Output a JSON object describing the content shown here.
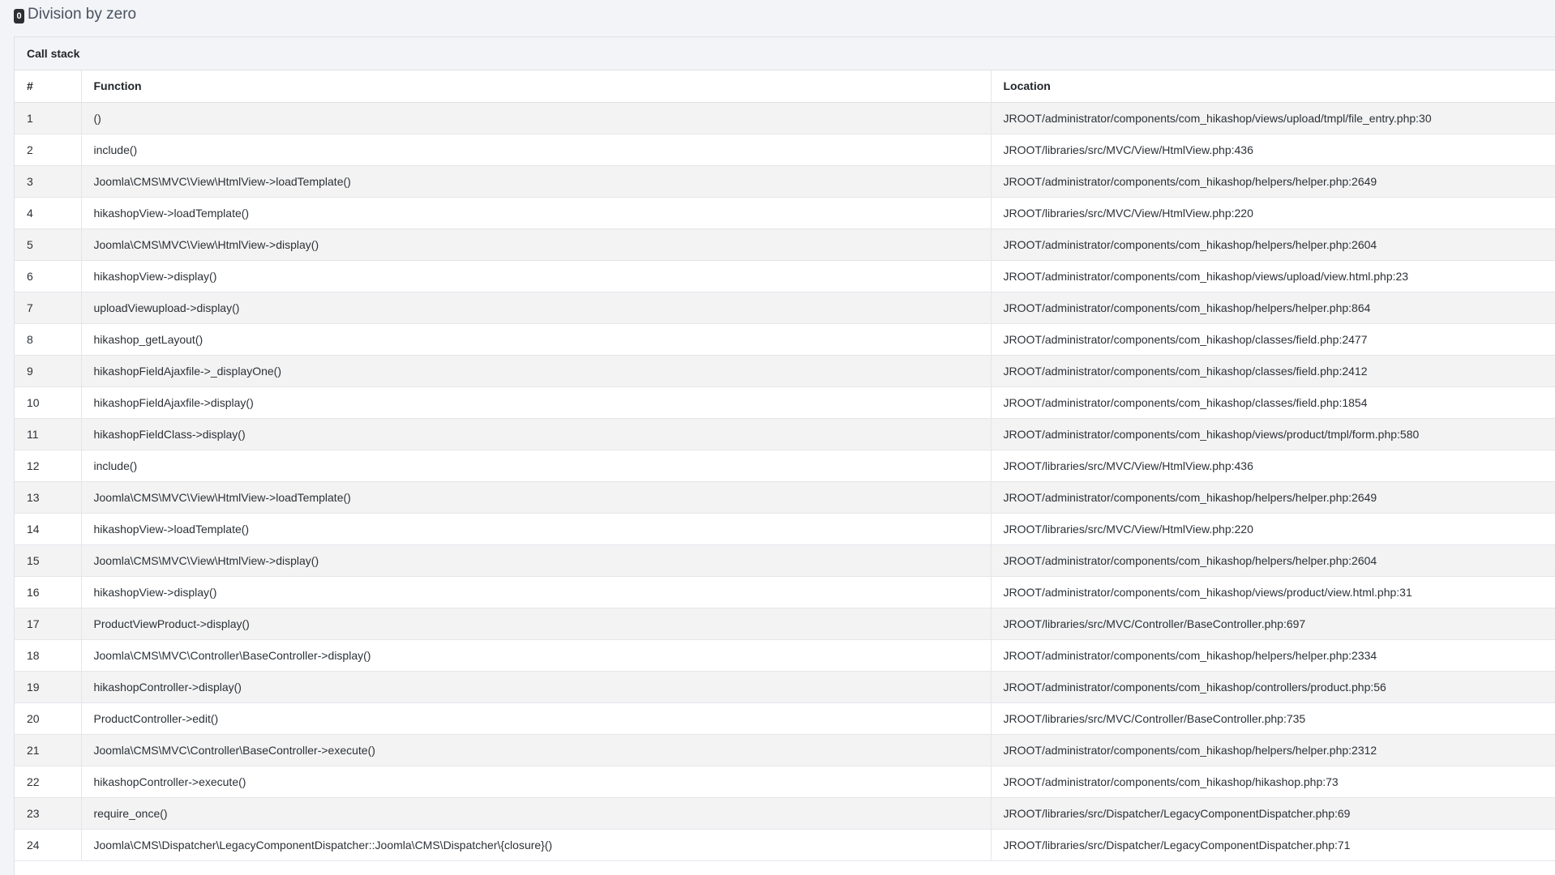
{
  "error": {
    "code": "0",
    "message": "Division by zero"
  },
  "call_stack": {
    "caption": "Call stack",
    "headers": {
      "num": "#",
      "function": "Function",
      "location": "Location"
    },
    "rows": [
      {
        "num": "1",
        "function": "()",
        "location": "JROOT/administrator/components/com_hikashop/views/upload/tmpl/file_entry.php:30"
      },
      {
        "num": "2",
        "function": "include()",
        "location": "JROOT/libraries/src/MVC/View/HtmlView.php:436"
      },
      {
        "num": "3",
        "function": "Joomla\\CMS\\MVC\\View\\HtmlView->loadTemplate()",
        "location": "JROOT/administrator/components/com_hikashop/helpers/helper.php:2649"
      },
      {
        "num": "4",
        "function": "hikashopView->loadTemplate()",
        "location": "JROOT/libraries/src/MVC/View/HtmlView.php:220"
      },
      {
        "num": "5",
        "function": "Joomla\\CMS\\MVC\\View\\HtmlView->display()",
        "location": "JROOT/administrator/components/com_hikashop/helpers/helper.php:2604"
      },
      {
        "num": "6",
        "function": "hikashopView->display()",
        "location": "JROOT/administrator/components/com_hikashop/views/upload/view.html.php:23"
      },
      {
        "num": "7",
        "function": "uploadViewupload->display()",
        "location": "JROOT/administrator/components/com_hikashop/helpers/helper.php:864"
      },
      {
        "num": "8",
        "function": "hikashop_getLayout()",
        "location": "JROOT/administrator/components/com_hikashop/classes/field.php:2477"
      },
      {
        "num": "9",
        "function": "hikashopFieldAjaxfile->_displayOne()",
        "location": "JROOT/administrator/components/com_hikashop/classes/field.php:2412"
      },
      {
        "num": "10",
        "function": "hikashopFieldAjaxfile->display()",
        "location": "JROOT/administrator/components/com_hikashop/classes/field.php:1854"
      },
      {
        "num": "11",
        "function": "hikashopFieldClass->display()",
        "location": "JROOT/administrator/components/com_hikashop/views/product/tmpl/form.php:580"
      },
      {
        "num": "12",
        "function": "include()",
        "location": "JROOT/libraries/src/MVC/View/HtmlView.php:436"
      },
      {
        "num": "13",
        "function": "Joomla\\CMS\\MVC\\View\\HtmlView->loadTemplate()",
        "location": "JROOT/administrator/components/com_hikashop/helpers/helper.php:2649"
      },
      {
        "num": "14",
        "function": "hikashopView->loadTemplate()",
        "location": "JROOT/libraries/src/MVC/View/HtmlView.php:220"
      },
      {
        "num": "15",
        "function": "Joomla\\CMS\\MVC\\View\\HtmlView->display()",
        "location": "JROOT/administrator/components/com_hikashop/helpers/helper.php:2604"
      },
      {
        "num": "16",
        "function": "hikashopView->display()",
        "location": "JROOT/administrator/components/com_hikashop/views/product/view.html.php:31"
      },
      {
        "num": "17",
        "function": "ProductViewProduct->display()",
        "location": "JROOT/libraries/src/MVC/Controller/BaseController.php:697"
      },
      {
        "num": "18",
        "function": "Joomla\\CMS\\MVC\\Controller\\BaseController->display()",
        "location": "JROOT/administrator/components/com_hikashop/helpers/helper.php:2334"
      },
      {
        "num": "19",
        "function": "hikashopController->display()",
        "location": "JROOT/administrator/components/com_hikashop/controllers/product.php:56"
      },
      {
        "num": "20",
        "function": "ProductController->edit()",
        "location": "JROOT/libraries/src/MVC/Controller/BaseController.php:735"
      },
      {
        "num": "21",
        "function": "Joomla\\CMS\\MVC\\Controller\\BaseController->execute()",
        "location": "JROOT/administrator/components/com_hikashop/helpers/helper.php:2312"
      },
      {
        "num": "22",
        "function": "hikashopController->execute()",
        "location": "JROOT/administrator/components/com_hikashop/hikashop.php:73"
      },
      {
        "num": "23",
        "function": "require_once()",
        "location": "JROOT/libraries/src/Dispatcher/LegacyComponentDispatcher.php:69"
      },
      {
        "num": "24",
        "function": "Joomla\\CMS\\Dispatcher\\LegacyComponentDispatcher::Joomla\\CMS\\Dispatcher\\{closure}()",
        "location": "JROOT/libraries/src/Dispatcher/LegacyComponentDispatcher.php:71"
      }
    ]
  }
}
